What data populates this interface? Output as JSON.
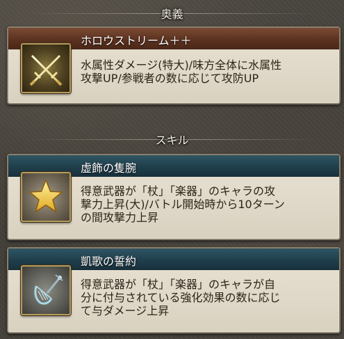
{
  "sections": {
    "ougi_title": "奥義",
    "skill_title": "スキル"
  },
  "ougi": {
    "name": "ホロウストリーム＋＋",
    "desc_lines": [
      "水属性ダメージ(特大)/味方全体に水属性",
      "攻撃UP/参戦者の数に応じて攻防UP"
    ],
    "icon": "crossed-swords-icon"
  },
  "skills": [
    {
      "name": "虚飾の隻腕",
      "desc_lines": [
        "得意武器が「杖」「楽器」のキャラの攻",
        "撃力上昇(大)/バトル開始時から10ターン",
        "の間攻撃力上昇"
      ],
      "icon": "star-icon"
    },
    {
      "name": "凱歌の誓約",
      "desc_lines": [
        "得意武器が「杖」「楽器」のキャラが自",
        "分に付与されている強化効果の数に応じ",
        "て与ダメージ上昇"
      ],
      "icon": "harp-staff-icon"
    }
  ],
  "colors": {
    "ougi_header": "#5a311f",
    "skill_header": "#1f3d4a",
    "card_bg": "#e2dbcb",
    "frame_gold": "#b89b5a"
  }
}
